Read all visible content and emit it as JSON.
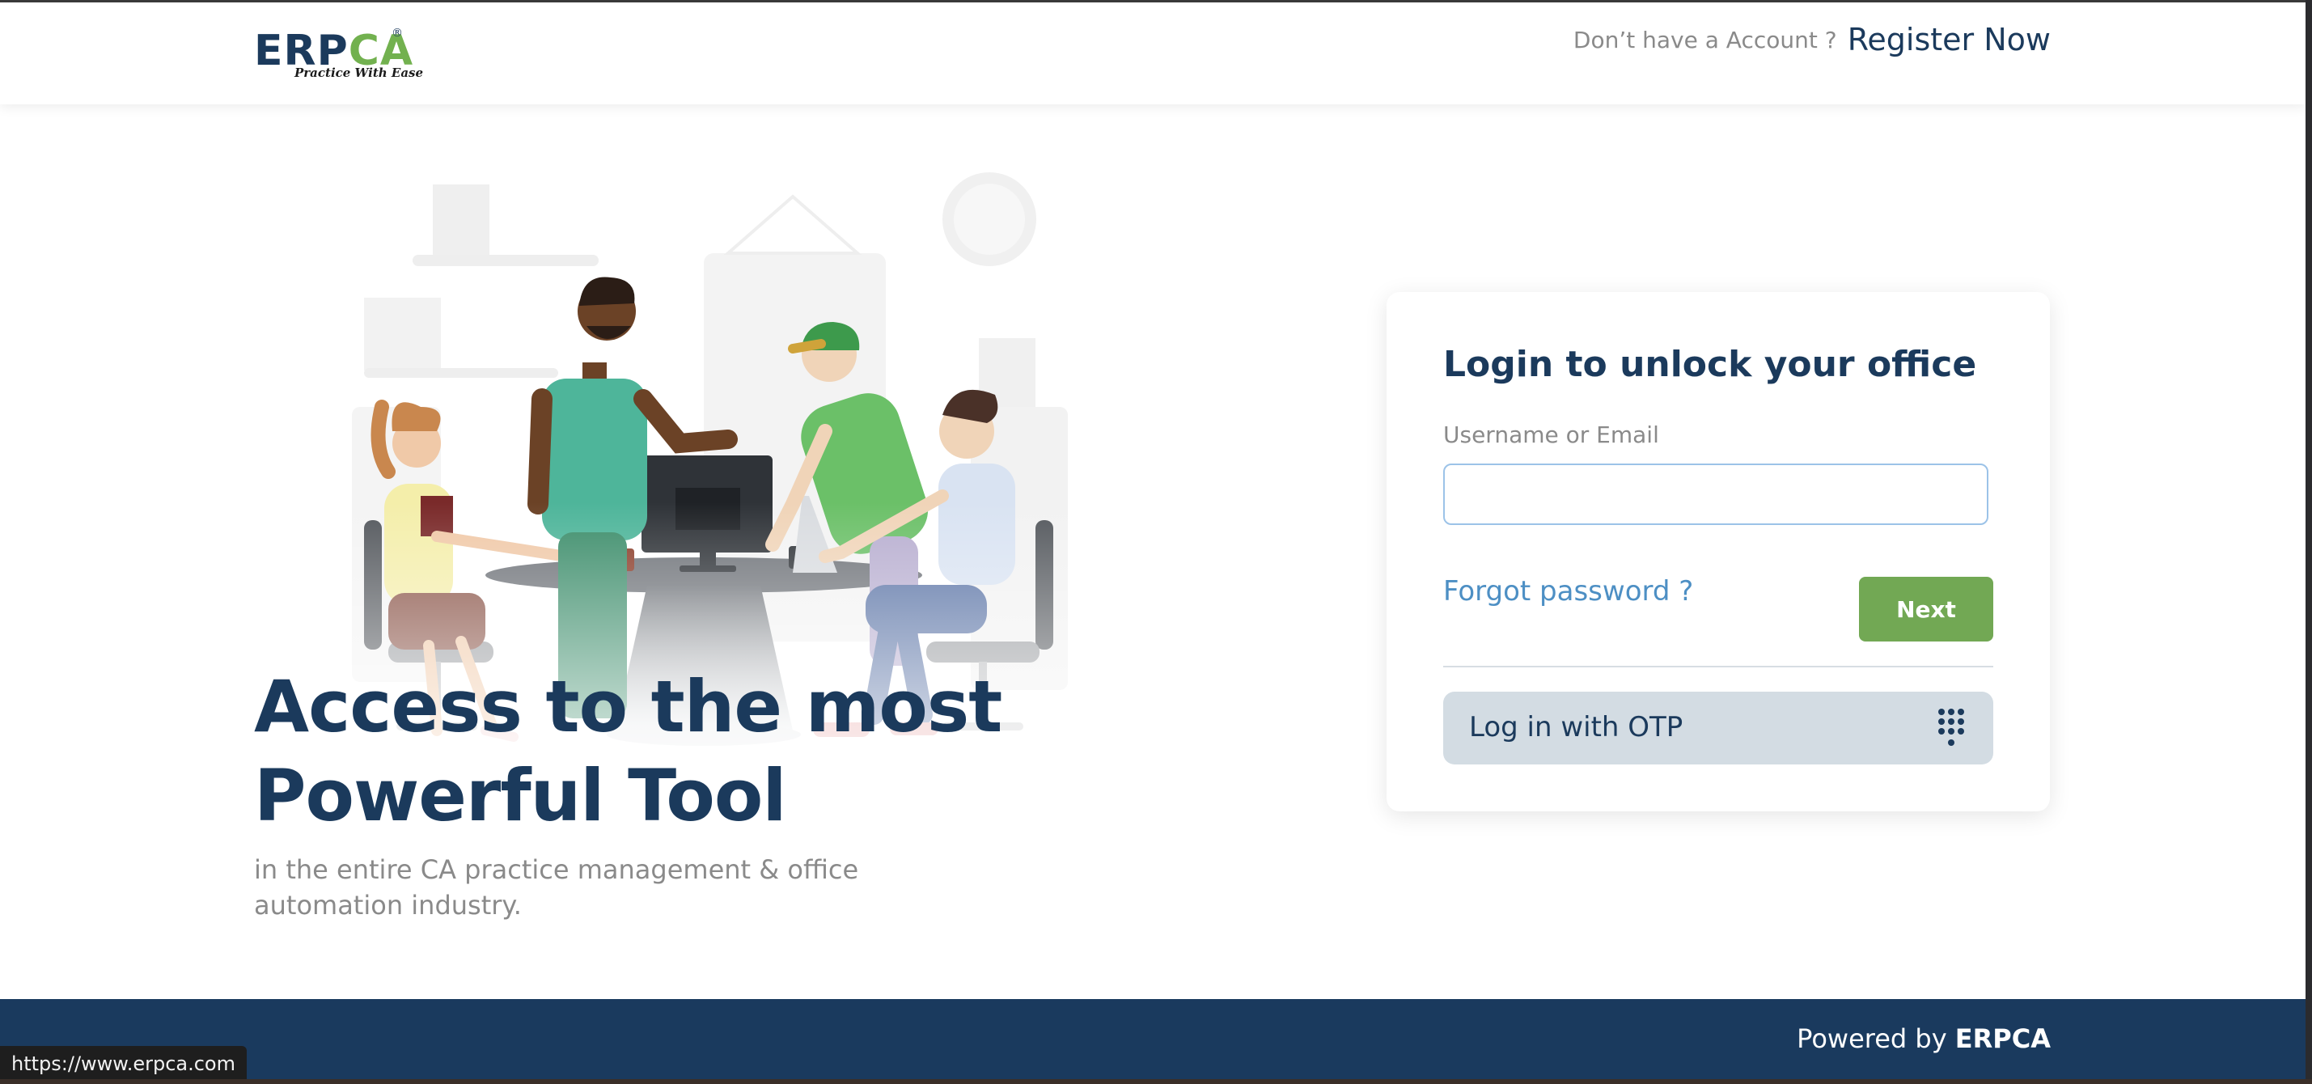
{
  "header": {
    "logo_letters_erp": "ERP",
    "logo_letters_ca": "CA",
    "logo_tagline": "Practice With Ease",
    "register_question": "Don’t have a Account ?",
    "register_link": "Register Now"
  },
  "hero": {
    "title_line1": "Access to the most",
    "title_line2": "Powerful Tool",
    "subtitle_line1": "in the entire CA practice management & office",
    "subtitle_line2": "automation industry."
  },
  "login": {
    "title": "Login to unlock your office",
    "username_label": "Username or Email",
    "username_value": "",
    "forgot_password": "Forgot password ?",
    "next_button": "Next",
    "otp_button": "Log in with OTP"
  },
  "footer": {
    "powered_by": "Powered by",
    "brand": "ERPCA"
  },
  "status_bar": {
    "url": "https://www.erpca.com"
  },
  "colors": {
    "brand_navy": "#1b3a5c",
    "brand_green": "#72a854",
    "link_blue": "#4d8fc4",
    "footer_bg": "#1a3a5e"
  }
}
